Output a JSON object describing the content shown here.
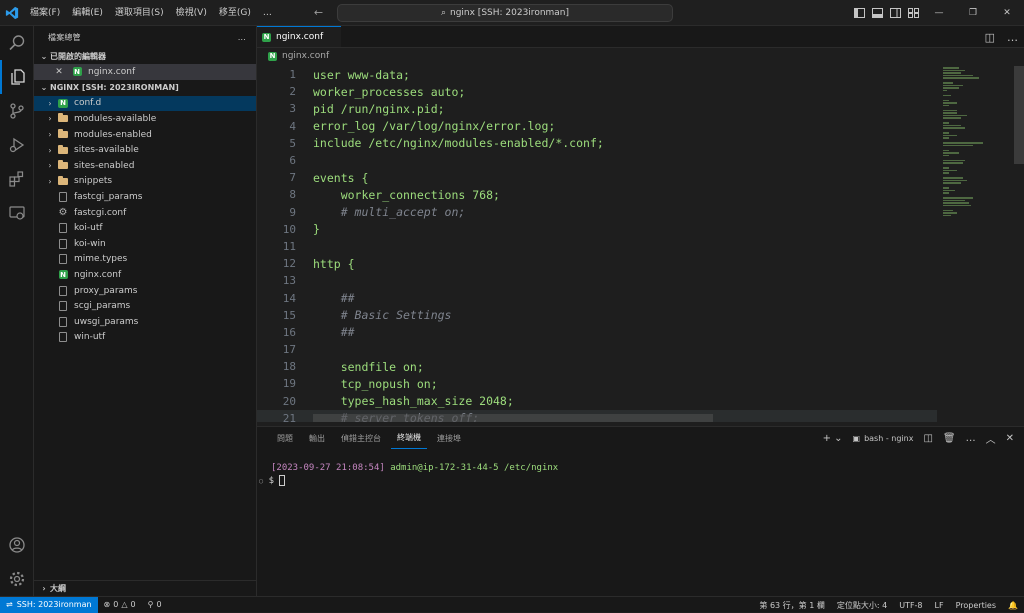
{
  "window": {
    "menu": [
      "檔案(F)",
      "編輯(E)",
      "選取項目(S)",
      "檢視(V)",
      "移至(G)",
      "…"
    ],
    "command_center": "nginx [SSH: 2023ironman]"
  },
  "sidebar": {
    "title": "檔案總管",
    "more": "…",
    "open_editors_label": "已開啟的編輯器",
    "open_editors": [
      {
        "name": "nginx.conf",
        "icon": "nginx-icon"
      }
    ],
    "folder_label": "NGINX [SSH: 2023IRONMAN]",
    "items": [
      {
        "name": "conf.d",
        "type": "folder-nginx",
        "collapsible": true
      },
      {
        "name": "modules-available",
        "type": "folder",
        "collapsible": true
      },
      {
        "name": "modules-enabled",
        "type": "folder",
        "collapsible": true
      },
      {
        "name": "sites-available",
        "type": "folder",
        "collapsible": true
      },
      {
        "name": "sites-enabled",
        "type": "folder",
        "collapsible": true
      },
      {
        "name": "snippets",
        "type": "folder",
        "collapsible": true
      },
      {
        "name": "fastcgi_params",
        "type": "file"
      },
      {
        "name": "fastcgi.conf",
        "type": "gear"
      },
      {
        "name": "koi-utf",
        "type": "file"
      },
      {
        "name": "koi-win",
        "type": "file"
      },
      {
        "name": "mime.types",
        "type": "file"
      },
      {
        "name": "nginx.conf",
        "type": "nginx"
      },
      {
        "name": "proxy_params",
        "type": "file"
      },
      {
        "name": "scgi_params",
        "type": "file"
      },
      {
        "name": "uwsgi_params",
        "type": "file"
      },
      {
        "name": "win-utf",
        "type": "file"
      }
    ],
    "outline_label": "大綱"
  },
  "editor": {
    "tab": "nginx.conf",
    "breadcrumb": "nginx.conf",
    "lines": [
      {
        "n": "1",
        "text": "user www-data;"
      },
      {
        "n": "2",
        "text": "worker_processes auto;"
      },
      {
        "n": "3",
        "text": "pid /run/nginx.pid;"
      },
      {
        "n": "4",
        "text": "error_log /var/log/nginx/error.log;"
      },
      {
        "n": "5",
        "text": "include /etc/nginx/modules-enabled/*.conf;"
      },
      {
        "n": "6",
        "text": ""
      },
      {
        "n": "7",
        "text": "events {"
      },
      {
        "n": "8",
        "text": "    worker_connections 768;"
      },
      {
        "n": "9",
        "text": "    # multi_accept on;"
      },
      {
        "n": "10",
        "text": "}"
      },
      {
        "n": "11",
        "text": ""
      },
      {
        "n": "12",
        "text": "http {"
      },
      {
        "n": "13",
        "text": ""
      },
      {
        "n": "14",
        "text": "    ##"
      },
      {
        "n": "15",
        "text": "    # Basic Settings"
      },
      {
        "n": "16",
        "text": "    ##"
      },
      {
        "n": "17",
        "text": ""
      },
      {
        "n": "18",
        "text": "    sendfile on;"
      },
      {
        "n": "19",
        "text": "    tcp_nopush on;"
      },
      {
        "n": "20",
        "text": "    types_hash_max_size 2048;"
      },
      {
        "n": "21",
        "text": "    # server_tokens off;"
      }
    ]
  },
  "panel": {
    "tabs": [
      "問題",
      "輸出",
      "偵錯主控台",
      "終端機",
      "連接埠"
    ],
    "active_tab": "終端機",
    "terminal_name": "bash - nginx",
    "prompt_time": "[2023-09-27 21:08:54]",
    "prompt_user": "admin@ip-172-31-44-5",
    "prompt_path": "/etc/nginx",
    "prompt_symbol": "$"
  },
  "status": {
    "remote": "SSH: 2023ironman",
    "errors": "0",
    "warnings": "0",
    "ports": "0",
    "cursor_pos": "第 63 行，第 1 欄",
    "indent": "定位點大小: 4",
    "encoding": "UTF-8",
    "eol": "LF",
    "language": "Properties"
  },
  "colors": {
    "accent": "#0078d4",
    "nginx_green": "#2fa14a",
    "folder": "#dcb67a"
  }
}
